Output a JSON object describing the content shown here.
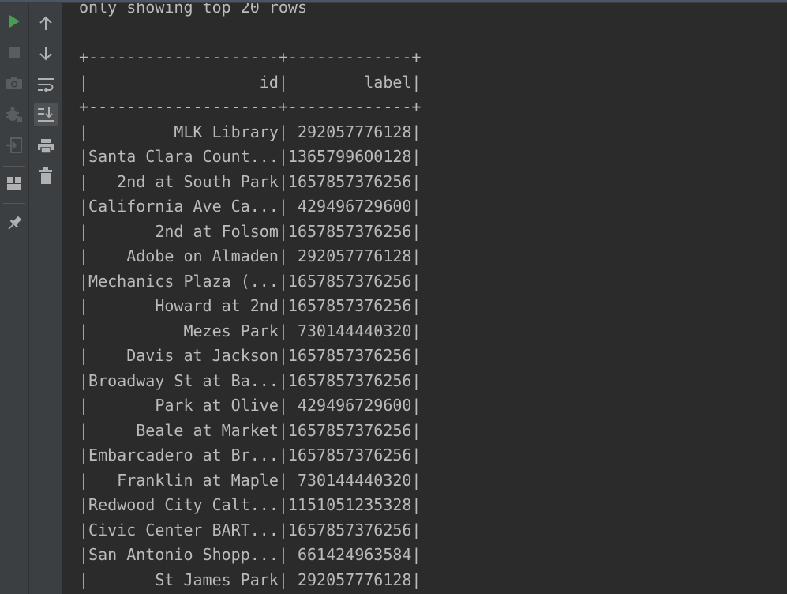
{
  "toolbar_left": {
    "icons": [
      {
        "name": "run-icon",
        "color": "#499c54"
      },
      {
        "name": "stop-icon",
        "color": "#6e6e6e"
      },
      {
        "name": "camera-icon",
        "color": "#6e6e6e"
      },
      {
        "name": "debug-icon",
        "color": "#6e6e6e"
      },
      {
        "name": "exit-icon",
        "color": "#6e6e6e"
      },
      {
        "name": "layout-icon",
        "color": "#afb1b3"
      },
      {
        "name": "pin-icon",
        "color": "#afb1b3"
      }
    ]
  },
  "toolbar_right": {
    "icons": [
      {
        "name": "arrow-up-icon"
      },
      {
        "name": "arrow-down-icon"
      },
      {
        "name": "soft-wrap-icon"
      },
      {
        "name": "scroll-to-end-icon",
        "active": true
      },
      {
        "name": "print-icon"
      },
      {
        "name": "trash-icon"
      }
    ]
  },
  "console": {
    "lines": [
      "only showing top 20 rows",
      "",
      "+--------------------+-------------+",
      "|                  id|        label|",
      "+--------------------+-------------+",
      "|         MLK Library| 292057776128|",
      "|Santa Clara Count...|1365799600128|",
      "|   2nd at South Park|1657857376256|",
      "|California Ave Ca...| 429496729600|",
      "|       2nd at Folsom|1657857376256|",
      "|    Adobe on Almaden| 292057776128|",
      "|Mechanics Plaza (...|1657857376256|",
      "|       Howard at 2nd|1657857376256|",
      "|          Mezes Park| 730144440320|",
      "|    Davis at Jackson|1657857376256|",
      "|Broadway St at Ba...|1657857376256|",
      "|       Park at Olive| 429496729600|",
      "|     Beale at Market|1657857376256|",
      "|Embarcadero at Br...|1657857376256|",
      "|   Franklin at Maple| 730144440320|",
      "|Redwood City Calt...|1151051235328|",
      "|Civic Center BART...|1657857376256|",
      "|San Antonio Shopp...| 661424963584|",
      "|       St James Park| 292057776128|"
    ]
  }
}
